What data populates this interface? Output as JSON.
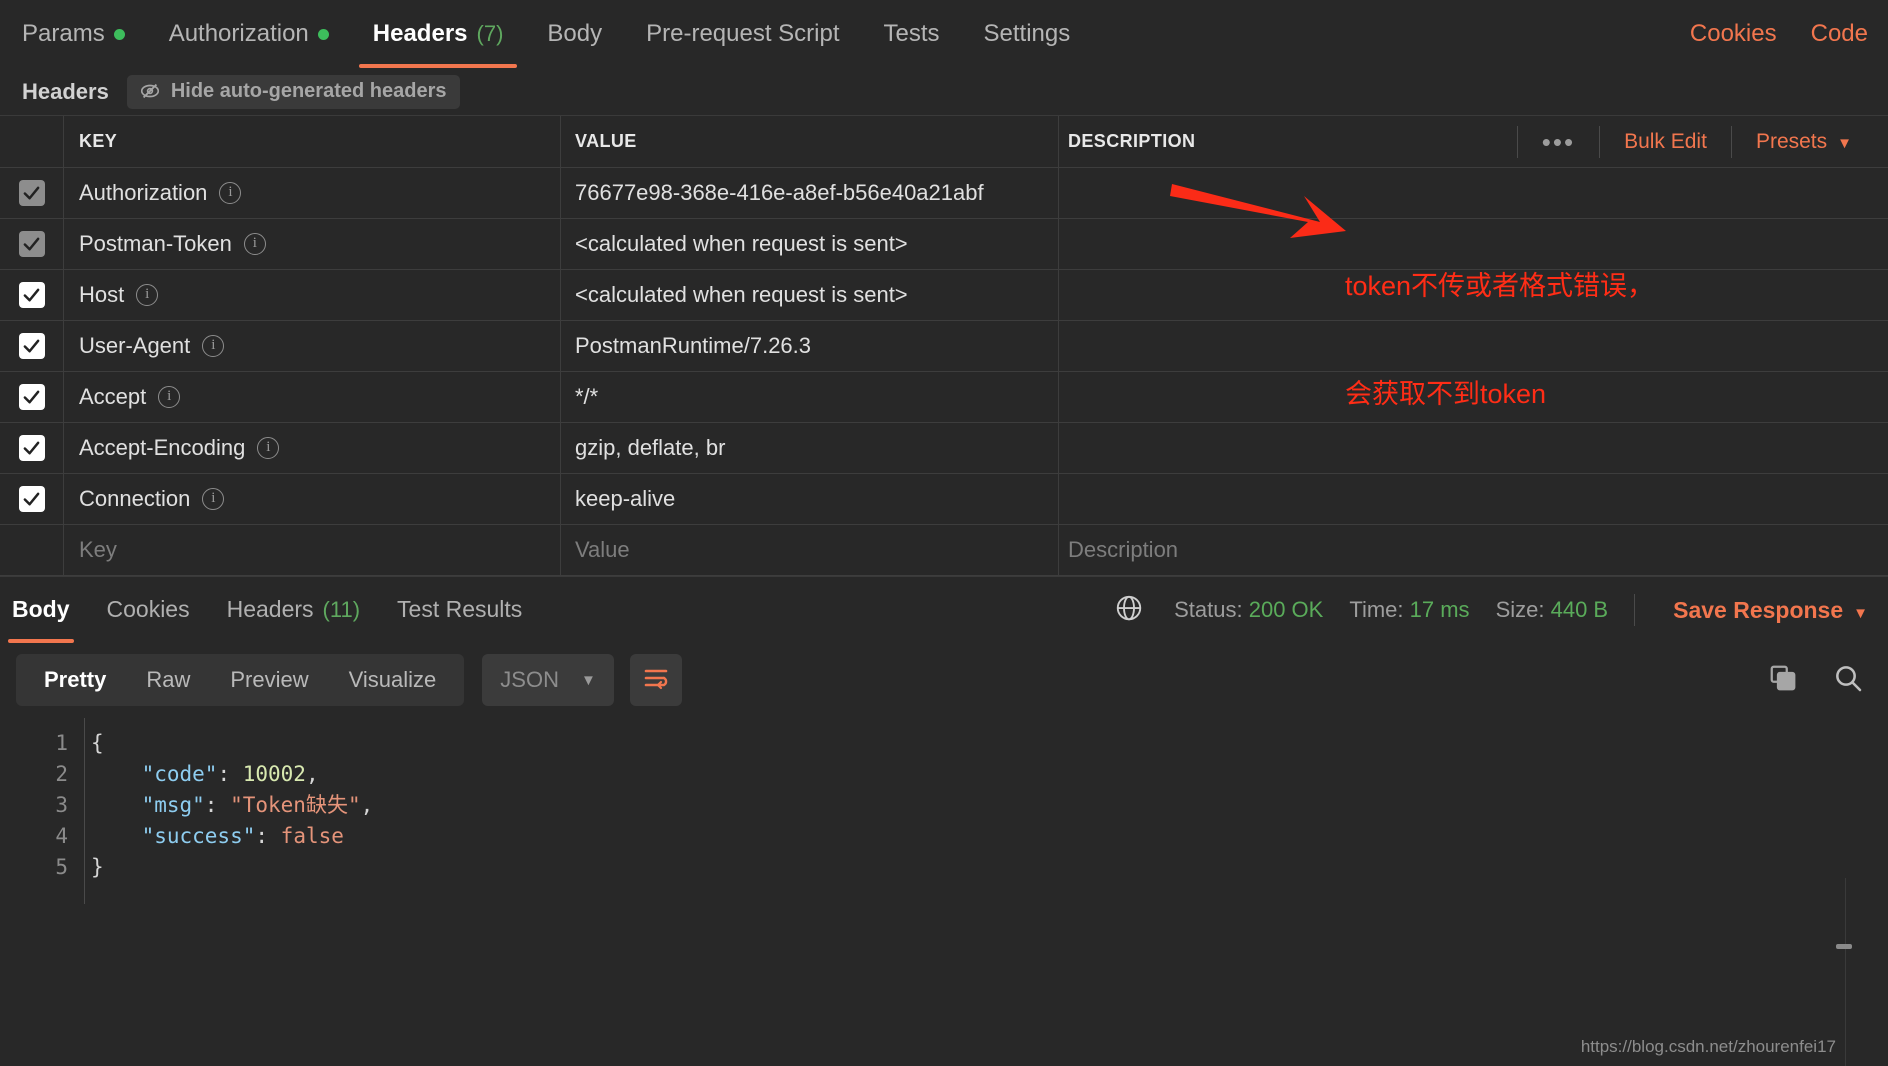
{
  "request_tabs": [
    {
      "label": "Params",
      "dot": true,
      "count": null,
      "active": false
    },
    {
      "label": "Authorization",
      "dot": true,
      "count": null,
      "active": false
    },
    {
      "label": "Headers",
      "dot": false,
      "count": "(7)",
      "active": true
    },
    {
      "label": "Body",
      "dot": false,
      "count": null,
      "active": false
    },
    {
      "label": "Pre-request Script",
      "dot": false,
      "count": null,
      "active": false
    },
    {
      "label": "Tests",
      "dot": false,
      "count": null,
      "active": false
    },
    {
      "label": "Settings",
      "dot": false,
      "count": null,
      "active": false
    }
  ],
  "tabbar_right": {
    "cookies": "Cookies",
    "code": "Code"
  },
  "sub_bar": {
    "label": "Headers",
    "hide_generated": "Hide auto-generated headers"
  },
  "table": {
    "columns": {
      "key": "KEY",
      "value": "VALUE",
      "description": "DESCRIPTION"
    },
    "tools": {
      "more": "•••",
      "bulk_edit": "Bulk Edit",
      "presets": "Presets"
    },
    "rows": [
      {
        "checked": true,
        "dim": true,
        "key": "Authorization",
        "value": "76677e98-368e-416e-a8ef-b56e40a21abf",
        "description": ""
      },
      {
        "checked": true,
        "dim": true,
        "key": "Postman-Token",
        "value": "<calculated when request is sent>",
        "description": ""
      },
      {
        "checked": true,
        "dim": false,
        "key": "Host",
        "value": "<calculated when request is sent>",
        "description": ""
      },
      {
        "checked": true,
        "dim": false,
        "key": "User-Agent",
        "value": "PostmanRuntime/7.26.3",
        "description": ""
      },
      {
        "checked": true,
        "dim": false,
        "key": "Accept",
        "value": "*/*",
        "description": ""
      },
      {
        "checked": true,
        "dim": false,
        "key": "Accept-Encoding",
        "value": "gzip, deflate, br",
        "description": ""
      },
      {
        "checked": true,
        "dim": false,
        "key": "Connection",
        "value": "keep-alive",
        "description": ""
      }
    ],
    "placeholder_row": {
      "key": "Key",
      "value": "Value",
      "description": "Description"
    }
  },
  "annotation": {
    "line1": "token不传或者格式错误，",
    "line2": "会获取不到token",
    "color": "#ff2d16"
  },
  "response": {
    "tabs": [
      {
        "label": "Body",
        "count": null,
        "active": true
      },
      {
        "label": "Cookies",
        "count": null,
        "active": false
      },
      {
        "label": "Headers",
        "count": "(11)",
        "active": false
      },
      {
        "label": "Test Results",
        "count": null,
        "active": false
      }
    ],
    "meta": {
      "status_label": "Status:",
      "status_value": "200 OK",
      "time_label": "Time:",
      "time_value": "17 ms",
      "size_label": "Size:",
      "size_value": "440 B",
      "save_response": "Save Response"
    },
    "toolbar": {
      "modes": [
        {
          "label": "Pretty",
          "active": true
        },
        {
          "label": "Raw",
          "active": false
        },
        {
          "label": "Preview",
          "active": false
        },
        {
          "label": "Visualize",
          "active": false
        }
      ],
      "format": "JSON"
    },
    "body_lines": [
      {
        "n": "1",
        "tokens": [
          {
            "t": "brace",
            "v": "{"
          }
        ]
      },
      {
        "n": "2",
        "tokens": [
          {
            "t": "plain",
            "v": "    "
          },
          {
            "t": "key",
            "v": "\"code\""
          },
          {
            "t": "punct",
            "v": ": "
          },
          {
            "t": "num",
            "v": "10002"
          },
          {
            "t": "punct",
            "v": ","
          }
        ]
      },
      {
        "n": "3",
        "tokens": [
          {
            "t": "plain",
            "v": "    "
          },
          {
            "t": "key",
            "v": "\"msg\""
          },
          {
            "t": "punct",
            "v": ": "
          },
          {
            "t": "str",
            "v": "\"Token缺失\""
          },
          {
            "t": "punct",
            "v": ","
          }
        ]
      },
      {
        "n": "4",
        "tokens": [
          {
            "t": "plain",
            "v": "    "
          },
          {
            "t": "key",
            "v": "\"success\""
          },
          {
            "t": "punct",
            "v": ": "
          },
          {
            "t": "bool",
            "v": "false"
          }
        ]
      },
      {
        "n": "5",
        "tokens": [
          {
            "t": "brace",
            "v": "}"
          }
        ]
      }
    ]
  },
  "watermark": "https://blog.csdn.net/zhourenfei17",
  "colors": {
    "accent": "#f2764e",
    "success_green": "#5aab5a",
    "dot_green": "#3dbd5c",
    "bg": "#282828"
  }
}
